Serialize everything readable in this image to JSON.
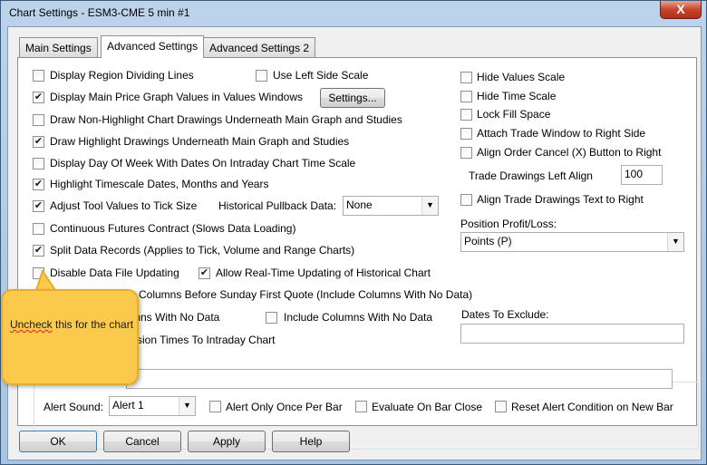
{
  "window": {
    "title": "Chart Settings - ESM3-CME  5 min   #1",
    "close_label": "X"
  },
  "tabs": [
    "Main Settings",
    "Advanced Settings",
    "Advanced Settings 2"
  ],
  "left_options": {
    "region_dividing": "Display Region Dividing Lines",
    "left_side_scale": "Use Left Side Scale",
    "main_price_values": "Display Main Price Graph Values in Values Windows",
    "settings_button": "Settings...",
    "non_highlight": "Draw Non-Highlight Chart Drawings Underneath Main Graph and Studies",
    "highlight": "Draw Highlight Drawings Underneath Main Graph and Studies",
    "day_of_week": "Display Day Of Week With Dates On Intraday Chart Time Scale",
    "highlight_timescale": "Highlight Timescale Dates, Months and Years",
    "adjust_tool": "Adjust Tool Values to Tick Size",
    "pullback_label": "Historical Pullback Data:",
    "pullback_value": "None",
    "continuous_futures": "Continuous Futures Contract (Slows Data Loading)",
    "split_records": "Split Data Records (Applies to Tick, Volume and Range Charts)",
    "disable_updating": "Disable Data File Updating",
    "realtime_updating": "Allow Real-Time Updating of Historical Chart",
    "sunday_columns": "Columns Before Sunday First Quote (Include Columns With No Data)",
    "columns_no_data_partial": "mns With No Data",
    "include_columns": "Include Columns With No Data",
    "session_times": "ssion Times To Intraday Chart"
  },
  "right_options": {
    "hide_values": "Hide Values Scale",
    "hide_time": "Hide Time Scale",
    "lock_fill": "Lock Fill Space",
    "attach_trade": "Attach Trade Window to Right Side",
    "align_order": "Align Order Cancel (X) Button to Right",
    "trade_left_align_label": "Trade Drawings Left Align",
    "trade_left_align_value": "100",
    "align_trade_text": "Align Trade Drawings Text to Right",
    "position_pl_label": "Position Profit/Loss:",
    "position_pl_value": "Points (P)",
    "dates_exclude_label": "Dates To Exclude:",
    "dates_exclude_value": ""
  },
  "alert": {
    "sound_label": "Alert Sound:",
    "sound_value": "Alert 1",
    "once_per_bar": "Alert Only Once Per Bar",
    "evaluate_close": "Evaluate On Bar Close",
    "reset_condition": "Reset Alert Condition on New Bar"
  },
  "buttons": {
    "ok": "OK",
    "cancel": "Cancel",
    "apply": "Apply",
    "help": "Help"
  },
  "callout": {
    "text_word": "Uncheck",
    "text_rest": "this for the chart"
  },
  "checked": {
    "main_price_values": true,
    "highlight": true,
    "highlight_timescale": true,
    "adjust_tool": true,
    "split_records": true,
    "realtime_updating": true
  },
  "icons": {
    "checkbox_mark": "✔",
    "dropdown_arrow": "▼"
  }
}
